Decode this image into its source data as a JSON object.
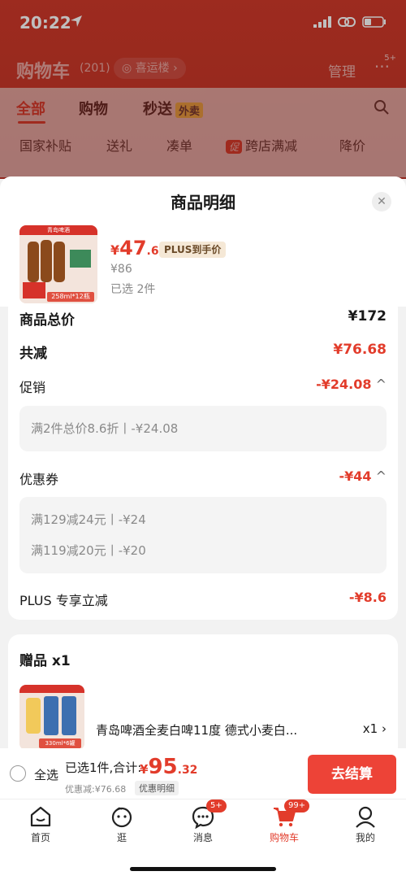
{
  "status": {
    "time": "20:22"
  },
  "header": {
    "title": "购物车",
    "count": "(201)",
    "location": "喜运楼",
    "manage": "管理",
    "more_badge": "5+"
  },
  "tabs": [
    {
      "label": "全部"
    },
    {
      "label": "购物"
    },
    {
      "label": "秒送",
      "tag": "外卖"
    }
  ],
  "chips": [
    "国家补贴",
    "送礼",
    "凑单",
    "跨店满减",
    "降价"
  ],
  "chip_promo_tag": "促",
  "sheet": {
    "title": "商品明细",
    "product": {
      "brand_text": "青岛啤酒",
      "spec_text": "258ml*12瓶",
      "price_symbol": "¥",
      "price_int": "47",
      "price_dec": ".66",
      "plus_tag": "PLUS到手价",
      "old_price": "¥86",
      "selected": "已选 2件"
    },
    "total_row": {
      "label": "商品总价",
      "value": "¥172"
    },
    "reduce_row": {
      "label": "共减",
      "value": "¥76.68"
    },
    "promo": {
      "label": "促销",
      "value": "-¥24.08",
      "detail": "满2件总价8.6折丨-¥24.08"
    },
    "coupon": {
      "label": "优惠券",
      "value": "-¥44",
      "details": [
        "满129减24元丨-¥24",
        "满119减20元丨-¥20"
      ]
    },
    "plus_row": {
      "label": "PLUS 专享立减",
      "value": "-¥8.6"
    },
    "gift": {
      "title": "赠品 x1",
      "name": "青岛啤酒全麦白啤11度 德式小麦白...",
      "qty": "x1",
      "spec_text": "330ml*6罐"
    }
  },
  "checkout": {
    "select_all": "全选",
    "summary": "已选1件,合计:",
    "total_symbol": "¥",
    "total_int": "95",
    "total_dec": ".32",
    "discount": "优惠减:¥76.68",
    "detail_tag": "优惠明细",
    "pay_button": "去结算"
  },
  "nav": [
    {
      "label": "首页",
      "icon": "home-icon"
    },
    {
      "label": "逛",
      "icon": "browse-icon"
    },
    {
      "label": "消息",
      "icon": "message-icon",
      "badge": "5+"
    },
    {
      "label": "购物车",
      "icon": "cart-icon",
      "badge": "99+",
      "active": true
    },
    {
      "label": "我的",
      "icon": "profile-icon"
    }
  ],
  "colors": {
    "accent": "#e23c2b",
    "pay_button": "#ed4337",
    "plus_tag_bg": "#f5e8d6"
  }
}
